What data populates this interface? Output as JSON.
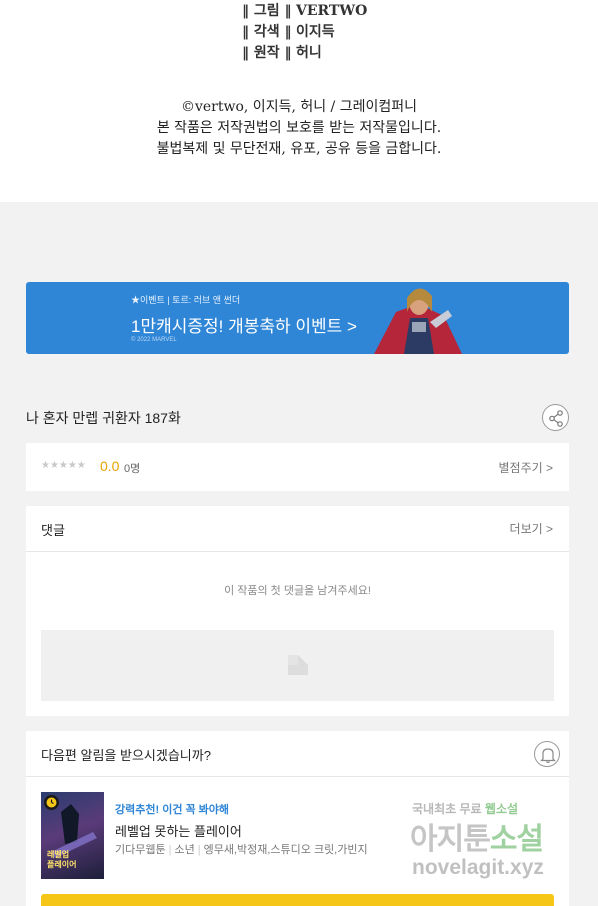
{
  "credits": [
    {
      "role": "‖ 그림 ‖",
      "name": "VERTWO"
    },
    {
      "role": "‖ 각색 ‖",
      "name": "이지득"
    },
    {
      "role": "‖ 원작 ‖",
      "name": "허니"
    }
  ],
  "copyright": {
    "line1": "©vertwo, 이지득, 허니 / 그레이컴퍼니",
    "line2": "본 작품은 저작권법의 보호를 받는 저작물입니다.",
    "line3": "불법복제 및 무단전재, 유포, 공유 등을 금합니다."
  },
  "banner": {
    "small": "★이벤트 | 토르: 러브 앤 썬더",
    "big": "1만캐시증정! 개봉축하 이벤트 >",
    "tiny": "© 2022 MARVEL"
  },
  "episode": {
    "title": "나 혼자 만렙 귀환자 187화"
  },
  "rating": {
    "stars": "★★★★★",
    "score": "0.0",
    "voters": "0명",
    "rate_link": "별점주기 >"
  },
  "comments": {
    "header": "댓글",
    "more_link": "더보기 >",
    "empty_message": "이 작품의 첫 댓글을 남겨주세요!"
  },
  "notify": {
    "question": "다음편 알림을 받으시겠습니까?",
    "reco_tag": "강력추천! 이건 꼭 봐야해",
    "reco_title": "레벨업 못하는 플레이어",
    "reco_genre": "기다무웹툰",
    "reco_target": "소년",
    "reco_authors": "엥무새,박정재,스튜디오 크릿,가빈지",
    "thumb_text": "레벨업\n플레이어"
  },
  "watermark": {
    "line1_a": "국내최초 무료 ",
    "line1_b": "웹소설",
    "line2_a": "아지툰",
    "line2_b": "소설",
    "line3": "novelagit.xyz"
  }
}
